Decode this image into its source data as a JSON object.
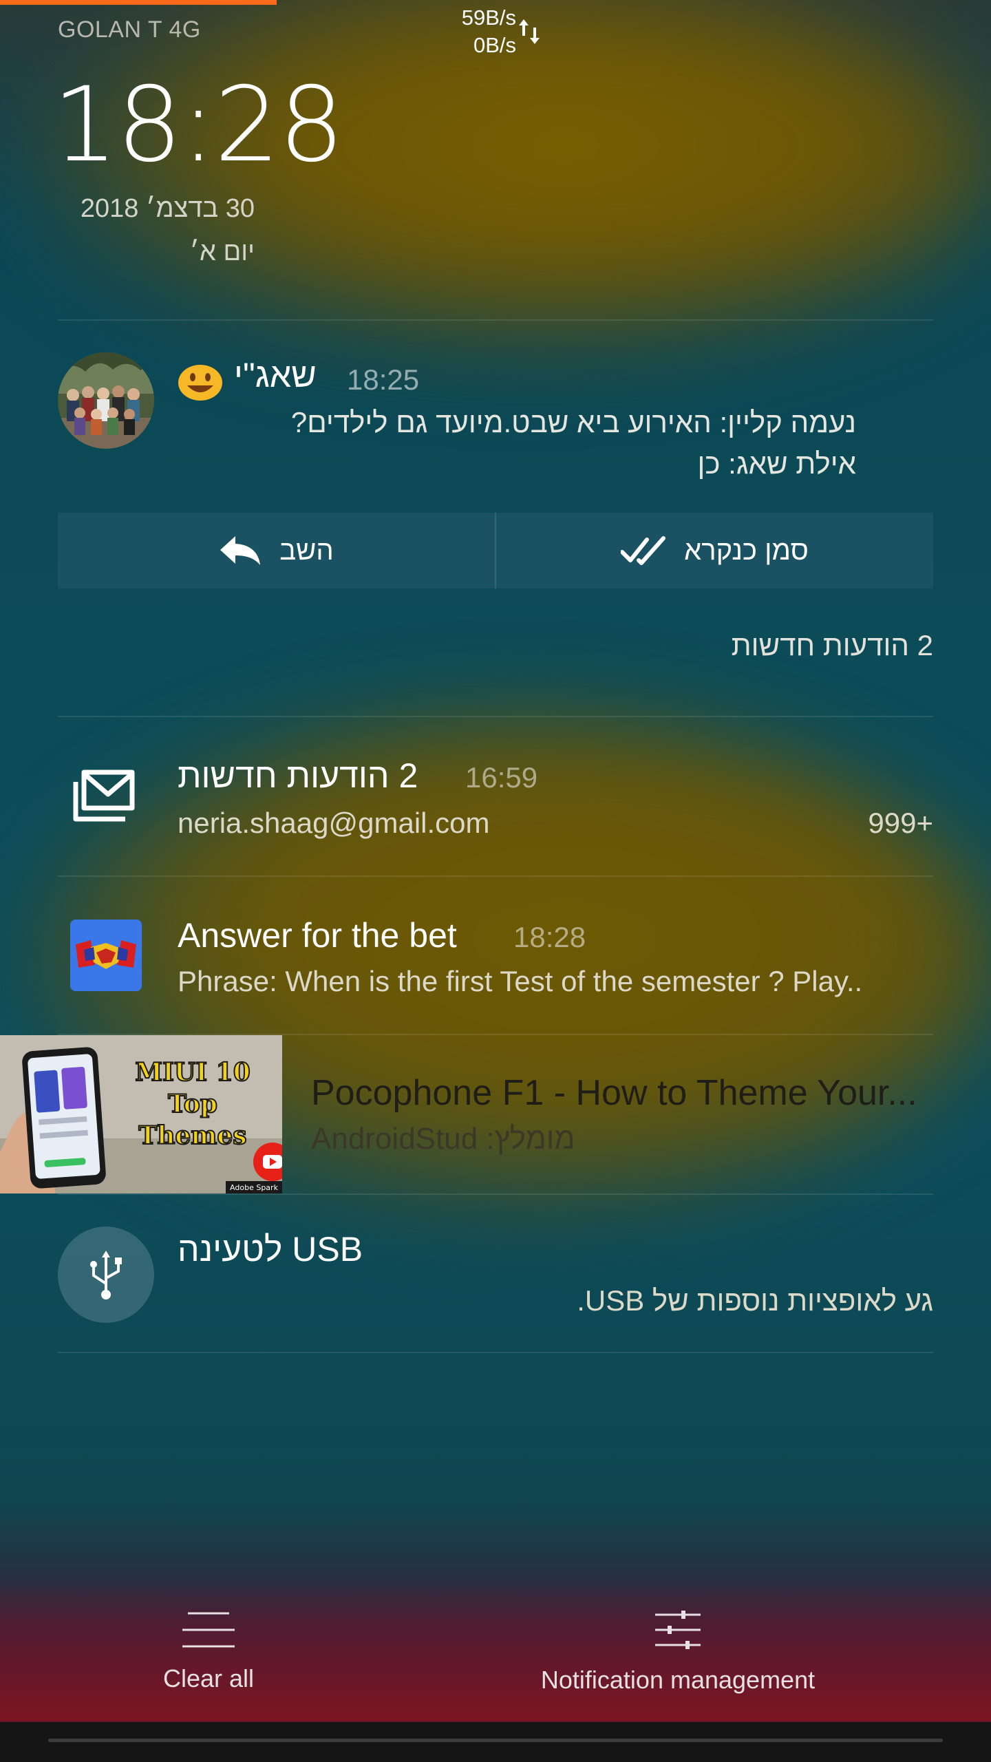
{
  "status_bar": {
    "carrier": "GOLAN T 4G",
    "upload_speed": "59B/s",
    "download_speed": "0B/s",
    "net_icon": "data-arrows-icon",
    "progress_color": "#ff6a1a"
  },
  "lockscreen": {
    "time": "18:28",
    "date": "30 בדצמ׳ 2018",
    "day": "יום א׳"
  },
  "notifications": {
    "whatsapp": {
      "avatar_icon": "group-avatar",
      "emoji_icon": "smiley-emoji-icon",
      "title": "שאג\"י",
      "time": "18:25",
      "messages": [
        "נעמה קליין: האירוע ביא שבט.מיועד גם לילדים?",
        "אילת שאג: כן"
      ],
      "actions": {
        "reply": "השב",
        "reply_icon": "reply-arrow-icon",
        "mark_read": "סמן כנקרא",
        "mark_read_icon": "double-check-icon"
      },
      "summary": "2 הודעות חדשות"
    },
    "gmail": {
      "icon": "gmail-envelope-icon",
      "title": "2 הודעות חדשות",
      "time": "16:59",
      "account": "neria.shaag@gmail.com",
      "count": "999+"
    },
    "bet_app": {
      "icon": "handshake-icon",
      "title": "Answer for the bet",
      "time": "18:28",
      "body": "Phrase: When is  the first Test  of the semester ? Play.."
    },
    "youtube": {
      "thumbnail": {
        "line1": "MIUI 10",
        "line2": "Top",
        "line3": "Themes",
        "badge": "Adobe Spark",
        "badge_icon": "youtube-play-icon"
      },
      "title": "Pocophone F1 - How to Theme Your...",
      "subtitle": "מומלץ: AndroidStud"
    },
    "usb": {
      "icon": "usb-icon",
      "title": "USB לטעינה",
      "body": "גע לאופציות נוספות של USB."
    }
  },
  "bottom_controls": {
    "clear_all": "Clear all",
    "clear_all_icon": "clear-lines-icon",
    "management": "Notification management",
    "management_icon": "sliders-icon"
  }
}
